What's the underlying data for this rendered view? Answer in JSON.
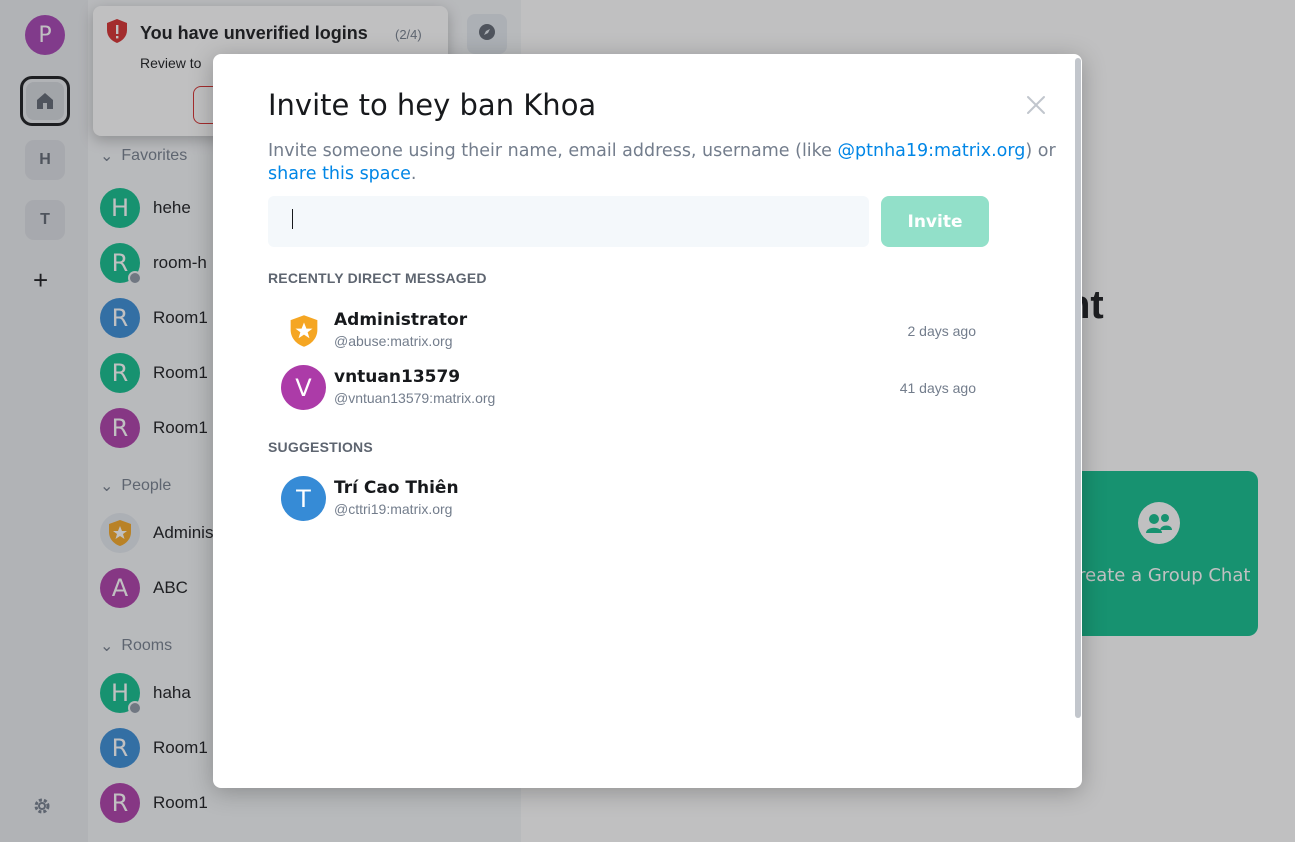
{
  "colors": {
    "accent": "#0dbd8b",
    "link": "#0086e6",
    "invite_disabled": "#92e0c9",
    "warning": "#d62b2b"
  },
  "sidebar": {
    "user_initial": "P",
    "spaces": [
      {
        "name": "Home",
        "icon": "home-icon"
      },
      {
        "letter": "H"
      },
      {
        "letter": "T"
      }
    ],
    "add_icon": "+",
    "settings_icon": "gear-icon"
  },
  "toast": {
    "title": "You have unverified logins",
    "count": "(2/4)",
    "body": "Review to"
  },
  "room_list": {
    "sections": {
      "favorites": "Favorites",
      "people": "People",
      "rooms": "Rooms"
    },
    "favorites": [
      {
        "initial": "H",
        "name": "hehe",
        "color": "#0dbd8b"
      },
      {
        "initial": "R",
        "name": "room-h",
        "color": "#0dbd8b"
      },
      {
        "initial": "R",
        "name": "Room1",
        "color": "#368bd6"
      },
      {
        "initial": "R",
        "name": "Room1",
        "color": "#0dbd8b"
      },
      {
        "initial": "R",
        "name": "Room1",
        "color": "#ac3ba8"
      }
    ],
    "people": [
      {
        "name": "Adminis"
      },
      {
        "initial": "A",
        "name": "ABC",
        "color": "#ac3ba8"
      }
    ],
    "rooms": [
      {
        "initial": "H",
        "name": "haha",
        "color": "#0dbd8b"
      },
      {
        "initial": "R",
        "name": "Room1",
        "color": "#368bd6"
      },
      {
        "initial": "R",
        "name": "Room1",
        "color": "#ac3ba8"
      }
    ]
  },
  "home": {
    "heading_fragment": "nt",
    "group_card_label": "Create a Group Chat"
  },
  "dialog": {
    "title": "Invite to hey ban Khoa",
    "subtitle_prefix": "Invite someone using their name, email address, username (like ",
    "subtitle_link_user": "@ptnha19:matrix.org",
    "subtitle_mid": ") or ",
    "subtitle_link_share": "share this space",
    "subtitle_end": ".",
    "input_value": "",
    "invite_label": "Invite",
    "recent_label": "RECENTLY DIRECT MESSAGED",
    "recent": [
      {
        "name": "Administrator",
        "id": "@abuse:matrix.org",
        "time": "2 days ago"
      },
      {
        "initial": "V",
        "name": "vntuan13579",
        "id": "@vntuan13579:matrix.org",
        "time": "41 days ago",
        "color": "#ac3ba8"
      }
    ],
    "suggestions_label": "SUGGESTIONS",
    "suggestions": [
      {
        "initial": "T",
        "name": "Trí Cao Thiên",
        "id": "@cttri19:matrix.org",
        "color": "#368bd6"
      }
    ]
  }
}
